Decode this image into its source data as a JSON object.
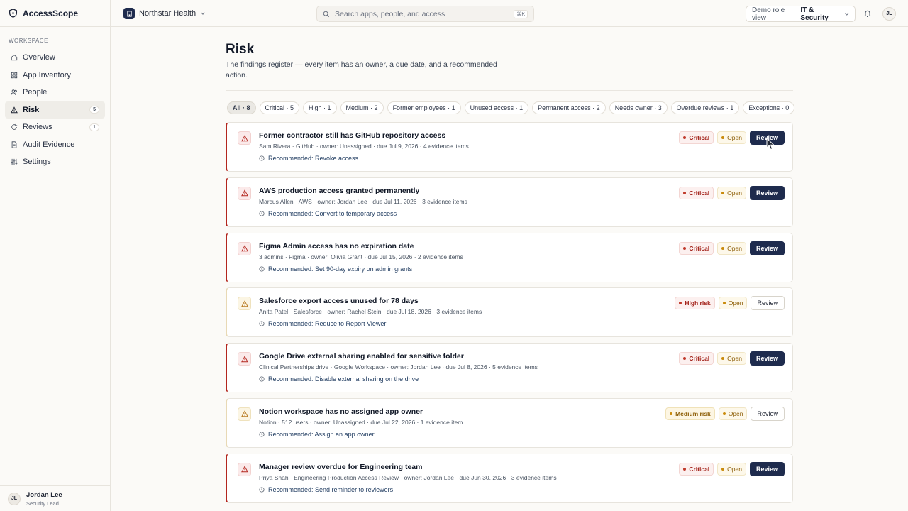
{
  "app": {
    "name": "AccessScope"
  },
  "sidebar": {
    "section_label": "WORKSPACE",
    "items": [
      {
        "label": "Overview",
        "icon": "home-icon",
        "active": false,
        "badge": ""
      },
      {
        "label": "App Inventory",
        "icon": "grid-icon",
        "active": false,
        "badge": ""
      },
      {
        "label": "People",
        "icon": "people-icon",
        "active": false,
        "badge": ""
      },
      {
        "label": "Risk",
        "icon": "warning-icon",
        "active": true,
        "badge": "5"
      },
      {
        "label": "Reviews",
        "icon": "refresh-icon",
        "active": false,
        "badge": "1"
      },
      {
        "label": "Audit Evidence",
        "icon": "document-icon",
        "active": false,
        "badge": ""
      },
      {
        "label": "Settings",
        "icon": "sliders-icon",
        "active": false,
        "badge": ""
      }
    ],
    "user": {
      "initials": "JL",
      "name": "Jordan Lee",
      "role": "Security Lead"
    }
  },
  "topbar": {
    "org_name": "Northstar Health",
    "search_placeholder": "Search apps, people, and access",
    "search_shortcut": "⌘K",
    "role_label": "Demo role view",
    "role_value": "IT & Security",
    "avatar_initials": "JL"
  },
  "page": {
    "title": "Risk",
    "description": "The findings register — every item has an owner, a due date, and a recommended action."
  },
  "filters": [
    {
      "label": "All · 8",
      "active": true
    },
    {
      "label": "Critical · 5",
      "active": false
    },
    {
      "label": "High · 1",
      "active": false
    },
    {
      "label": "Medium · 2",
      "active": false
    },
    {
      "label": "Former employees · 1",
      "active": false
    },
    {
      "label": "Unused access · 1",
      "active": false
    },
    {
      "label": "Permanent access · 2",
      "active": false
    },
    {
      "label": "Needs owner · 3",
      "active": false
    },
    {
      "label": "Overdue reviews · 1",
      "active": false
    },
    {
      "label": "Exceptions · 0",
      "active": false
    }
  ],
  "findings": [
    {
      "title": "Former contractor still has GitHub repository access",
      "meta": "Sam Rivera · GitHub · owner: Unassigned · due Jul 9, 2026 · 4 evidence items",
      "recommendation": "Recommended: Revoke access",
      "severity": "Critical",
      "severity_class": "critical",
      "status": "Open",
      "action": "Review",
      "primary": true
    },
    {
      "title": "AWS production access granted permanently",
      "meta": "Marcus Allen · AWS · owner: Jordan Lee · due Jul 11, 2026 · 3 evidence items",
      "recommendation": "Recommended: Convert to temporary access",
      "severity": "Critical",
      "severity_class": "critical",
      "status": "Open",
      "action": "Review",
      "primary": true
    },
    {
      "title": "Figma Admin access has no expiration date",
      "meta": "3 admins · Figma · owner: Olivia Grant · due Jul 15, 2026 · 2 evidence items",
      "recommendation": "Recommended: Set 90-day expiry on admin grants",
      "severity": "Critical",
      "severity_class": "critical",
      "status": "Open",
      "action": "Review",
      "primary": true
    },
    {
      "title": "Salesforce export access unused for 78 days",
      "meta": "Anita Patel · Salesforce · owner: Rachel Stein · due Jul 18, 2026 · 3 evidence items",
      "recommendation": "Recommended: Reduce to Report Viewer",
      "severity": "High risk",
      "severity_class": "high",
      "status": "Open",
      "action": "Review",
      "primary": false
    },
    {
      "title": "Google Drive external sharing enabled for sensitive folder",
      "meta": "Clinical Partnerships drive · Google Workspace · owner: Jordan Lee · due Jul 8, 2026 · 5 evidence items",
      "recommendation": "Recommended: Disable external sharing on the drive",
      "severity": "Critical",
      "severity_class": "critical",
      "status": "Open",
      "action": "Review",
      "primary": true
    },
    {
      "title": "Notion workspace has no assigned app owner",
      "meta": "Notion · 512 users · owner: Unassigned · due Jul 22, 2026 · 1 evidence item",
      "recommendation": "Recommended: Assign an app owner",
      "severity": "Medium risk",
      "severity_class": "medium",
      "status": "Open",
      "action": "Review",
      "primary": false
    },
    {
      "title": "Manager review overdue for Engineering team",
      "meta": "Priya Shah · Engineering Production Access Review · owner: Jordan Lee · due Jun 30, 2026 · 3 evidence items",
      "recommendation": "Recommended: Send reminder to reviewers",
      "severity": "Critical",
      "severity_class": "critical",
      "status": "Open",
      "action": "Review",
      "primary": true
    }
  ]
}
